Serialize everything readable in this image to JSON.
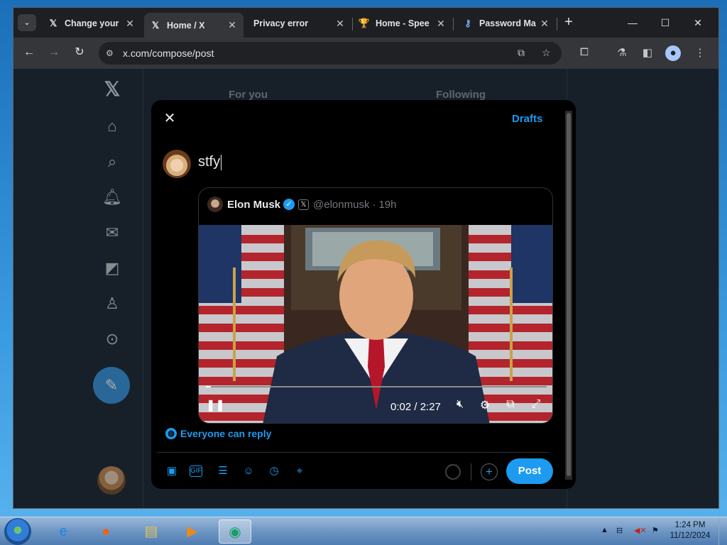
{
  "browser": {
    "tabs": [
      {
        "title": "Change your",
        "icon": "x-logo-icon"
      },
      {
        "title": "Home / X",
        "icon": "x-logo-icon",
        "active": true
      },
      {
        "title": "Privacy error",
        "icon": "none"
      },
      {
        "title": "Home - Spee",
        "icon": "trophy-icon"
      },
      {
        "title": "Password Ma",
        "icon": "key-icon"
      }
    ],
    "url": "x.com/compose/post"
  },
  "page": {
    "feed_tabs": [
      "For you",
      "Following"
    ]
  },
  "composer": {
    "drafts_label": "Drafts",
    "text": "stfy",
    "reply_setting": "Everyone can reply",
    "post_label": "Post",
    "quoted": {
      "name": "Elon Musk",
      "handle": "@elonmusk",
      "time": "19h",
      "video_time": "0:02 / 2:27",
      "progress_fraction": 0.015
    }
  },
  "taskbar": {
    "time": "1:24 PM",
    "date": "11/12/2024"
  },
  "colors": {
    "accent": "#1d9bf0",
    "modal_bg": "#000000",
    "page_bg": "#1f2933"
  }
}
